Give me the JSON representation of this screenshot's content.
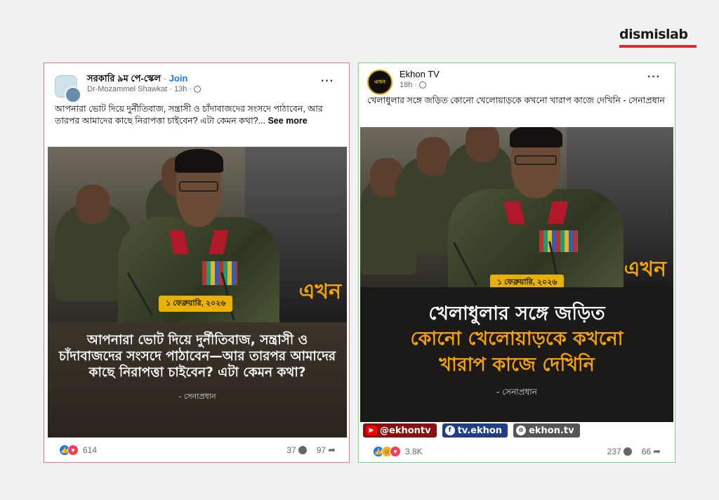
{
  "brand": {
    "name": "dismislab"
  },
  "left_post": {
    "group_name": "সরকারি ৯ম পে-স্কেল",
    "separator": "·",
    "join_label": "Join",
    "author": "Dr-Mozammel Shawkat",
    "time": "· 13h ·",
    "caption": "আপনারা ভোট দিয়ে দুর্নীতিবাজ, সন্ত্রাসী ও চাঁদাবাজদের সংসদে পাঠাবেন, আর তারপর আমাদের কাছে নিরাপত্তা চাইবেন? এটা কেমন কথা?...",
    "see_more": "See more",
    "image": {
      "logo": "এখন",
      "date": "১ ফেব্রুয়ারি, ২০২৬",
      "quote": "আপনারা ভোট দিয়ে দুর্নীতিবাজ, সন্ত্রাসী ও চাঁদাবাজদের সংসদে পাঠাবেন—আর তারপর আমাদের কাছে নিরাপত্তা চাইবেন? এটা কেমন কথা?",
      "attribution": "- সেনাপ্রধান"
    },
    "reactions_count": "614",
    "comments_count": "37",
    "shares_count": "97"
  },
  "right_post": {
    "page_name": "Ekhon TV",
    "avatar_text": "এখন",
    "time": "18h ·",
    "caption": "খেলাধুলার সঙ্গে জড়িত কোনো খেলোয়াড়কে কখনো খারাপ কাজে দেখিনি - সেনাপ্রধান",
    "image": {
      "logo": "এখন",
      "date": "১ ফেব্রুয়ারি, ২০২৬",
      "quote_line1": "খেলাধুলার সঙ্গে জড়িত",
      "quote_line2": "কোনো খেলোয়াড়কে কখনো",
      "quote_line3": "খারাপ কাজে দেখিনি",
      "attribution": "- সেনাপ্রধান",
      "youtube": "@ekhontv",
      "facebook": "tv.ekhon",
      "website": "ekhon.tv"
    },
    "reactions_count": "3.8K",
    "comments_count": "237",
    "shares_count": "66"
  },
  "colors": {
    "left_frame": "#e07a7a",
    "right_frame": "#7fd07f",
    "ekhon_accent": "#f5a300",
    "fb_link": "#1877f2"
  }
}
